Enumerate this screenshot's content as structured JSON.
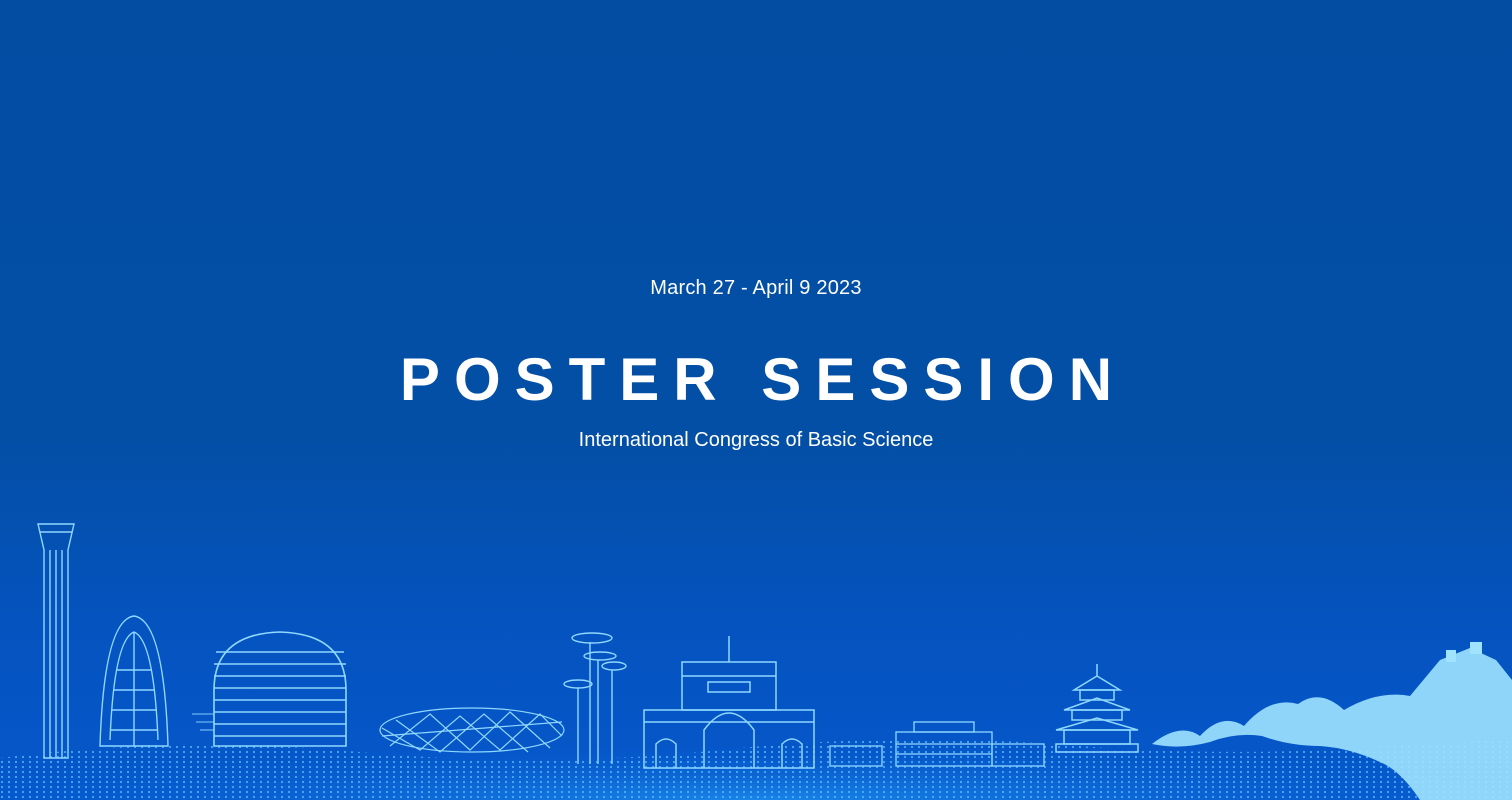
{
  "event": {
    "date": "March 27 - April 9 2023",
    "title": "POSTER SESSION",
    "subtitle": "International Congress of Basic Science"
  },
  "colors": {
    "background": "#034ea3",
    "text": "#ffffff",
    "skyline": "#8fd8ff",
    "skyline_fill": "#9fe3ff"
  },
  "illustration": {
    "landmarks": [
      "cctv-tower-icon",
      "tall-arched-building-icon",
      "dome-building-icon",
      "birds-nest-stadium-icon",
      "olympic-tower-icon",
      "university-gate-icon",
      "low-building-icon",
      "temple-of-heaven-icon",
      "great-wall-icon"
    ]
  }
}
